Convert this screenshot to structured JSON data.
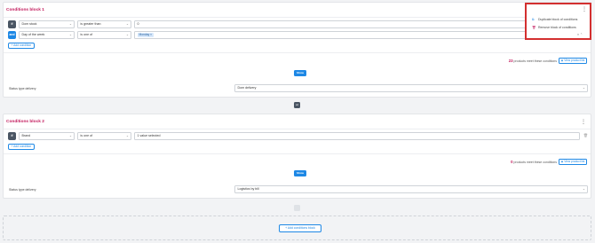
{
  "block1": {
    "title": "Conditions block 1",
    "conditions": [
      {
        "badge": "if",
        "field": "Dom stock",
        "operator": "is greater than",
        "value": "0"
      },
      {
        "badge": "and",
        "field": "Day of the week",
        "operator": "is one of",
        "chip": "Monday"
      }
    ],
    "add_condition_label": "Add condition",
    "show_label": "Show",
    "count": "23",
    "count_text": "products meet these conditions",
    "view_label": "View product list",
    "status_label": "Status type delivery",
    "status_value": "Dom delivery"
  },
  "menu": {
    "items": [
      "Duplicate block of conditions",
      "Remove block of conditions"
    ],
    "close_symbol": "×",
    "chevron": "⌃"
  },
  "connector": {
    "or_label": "or"
  },
  "block2": {
    "title": "Conditions block 2",
    "conditions": [
      {
        "badge": "if",
        "field": "Brand",
        "operator": "is one of",
        "value": "1 value selected"
      }
    ],
    "add_condition_label": "Add condition",
    "show_label": "Show",
    "count": "0",
    "count_text": "products meet these conditions",
    "view_label": "View product list",
    "status_label": "Status type delivery",
    "status_value": "Logistics by bill"
  },
  "add_block_label": "Add conditions block",
  "icons": {
    "kebab": "⋮",
    "chevron_down": "⌄",
    "plus": "+",
    "copy": "⧉",
    "trash": "🗑",
    "eye": "◉"
  },
  "colors": {
    "accent": "#1e88e5",
    "title": "#c2185b",
    "highlight": "#d32f2f"
  }
}
